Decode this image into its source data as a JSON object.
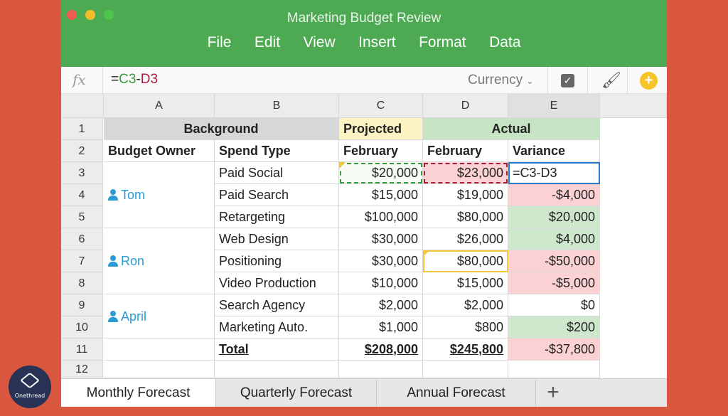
{
  "window": {
    "title": "Marketing Budget Review",
    "menu": [
      "File",
      "Edit",
      "View",
      "Insert",
      "Format",
      "Data"
    ]
  },
  "formula_bar": {
    "fx": "fx",
    "formula_prefix": "=",
    "ref1": "C3",
    "op": "-",
    "ref2": "D3",
    "format": "Currency",
    "chevron": "⌄",
    "check": "✓",
    "brush": "🖌",
    "add_comment": "+"
  },
  "columns": [
    "A",
    "B",
    "C",
    "D",
    "E"
  ],
  "rows": [
    "1",
    "2",
    "3",
    "4",
    "5",
    "6",
    "7",
    "8",
    "9",
    "10",
    "11",
    "12"
  ],
  "headers": {
    "background": "Background",
    "projected": "Projected",
    "actual": "Actual",
    "budget_owner": "Budget Owner",
    "spend_type": "Spend Type",
    "proj_month": "February",
    "act_month": "February",
    "variance": "Variance"
  },
  "owners": [
    "Tom",
    "Ron",
    "April"
  ],
  "data_rows": [
    {
      "spend": "Paid Social",
      "projected": "$20,000",
      "actual": "$23,000",
      "variance": "=C3-D3"
    },
    {
      "spend": "Paid Search",
      "projected": "$15,000",
      "actual": "$19,000",
      "variance": "-$4,000"
    },
    {
      "spend": "Retargeting",
      "projected": "$100,000",
      "actual": "$80,000",
      "variance": "$20,000"
    },
    {
      "spend": "Web Design",
      "projected": "$30,000",
      "actual": "$26,000",
      "variance": "$4,000"
    },
    {
      "spend": "Positioning",
      "projected": "$30,000",
      "actual": "$80,000",
      "variance": "-$50,000"
    },
    {
      "spend": "Video Production",
      "projected": "$10,000",
      "actual": "$15,000",
      "variance": "-$5,000"
    },
    {
      "spend": "Search Agency",
      "projected": "$2,000",
      "actual": "$2,000",
      "variance": "$0"
    },
    {
      "spend": "Marketing Auto.",
      "projected": "$1,000",
      "actual": "$800",
      "variance": "$200"
    },
    {
      "spend": "Total",
      "projected": "$208,000",
      "actual": "$245,800",
      "variance": "-$37,800"
    }
  ],
  "tabs": [
    "Monthly Forecast",
    "Quarterly Forecast",
    "Annual Forecast"
  ],
  "add_tab": "+",
  "brand": {
    "name": "Onethread"
  },
  "colors": {
    "titlebar": "#4daa52",
    "frame": "#d9573e",
    "owner_link": "#2a9bd6",
    "negative_fill": "#fbd1d4",
    "positive_fill": "#cfe8cd"
  }
}
